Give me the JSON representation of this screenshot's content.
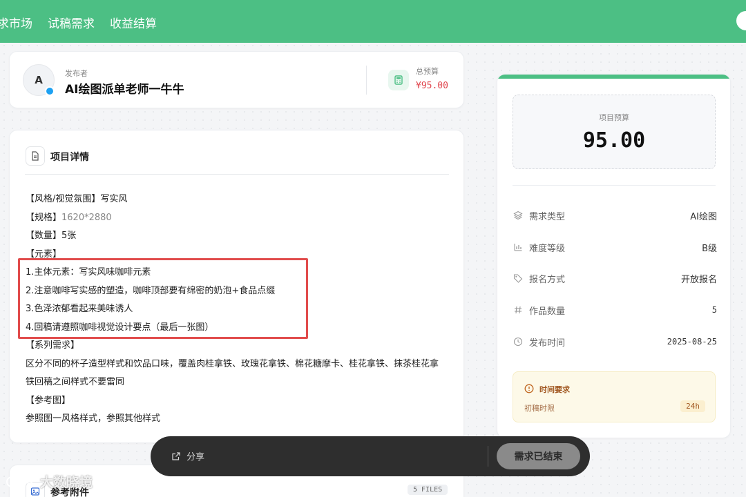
{
  "topnav": {
    "items": [
      "求市场",
      "试稿需求",
      "收益结算"
    ]
  },
  "publisher": {
    "avatar_letter": "A",
    "label": "发布者",
    "name": "AI绘图派单老师一牛牛",
    "budget_label": "总预算",
    "budget_value": "¥95.00"
  },
  "detail": {
    "title": "项目详情",
    "lines": [
      "【风格/视觉氛围】写实风",
      "【规格】1620*2880",
      "【数量】5张",
      "【元素】",
      "1.主体元素：写实风味咖啡元素",
      "2.注意咖啡写实感的塑造，咖啡顶部要有绵密的奶泡+食品点缀",
      "3.色泽浓郁看起来美味诱人",
      "4.回稿请遵照咖啡视觉设计要点（最后一张图）",
      "【系列需求】",
      "区分不同的杯子造型样式和饮品口味，覆盖肉桂拿铁、玫瑰花拿铁、棉花糖摩卡、桂花拿铁、抹茶桂花拿",
      "铁回稿之间样式不要雷同",
      "【参考图】",
      "参照图一风格样式，参照其他样式"
    ],
    "spec_prefix": "【规格】",
    "spec_value": "1620*2880"
  },
  "attachments": {
    "title": "参考附件",
    "badge": "5 FILES"
  },
  "side": {
    "budget_label": "项目预算",
    "budget_value": "95.00",
    "rows": [
      {
        "label": "需求类型",
        "value": "AI绘图",
        "icon": "layers-icon"
      },
      {
        "label": "难度等级",
        "value": "B级",
        "icon": "bar-chart-icon"
      },
      {
        "label": "报名方式",
        "value": "开放报名",
        "icon": "tag-icon"
      },
      {
        "label": "作品数量",
        "value": "5",
        "icon": "hash-icon"
      },
      {
        "label": "发布时间",
        "value": "2025-08-25",
        "icon": "clock-icon"
      }
    ],
    "time": {
      "title": "时间要求",
      "sub_label": "初稿时限",
      "value": "24h"
    }
  },
  "bottom_bar": {
    "share_label": "分享",
    "ended_label": "需求已结束"
  },
  "watermark": {
    "text": "大数晓境"
  },
  "colors": {
    "brand_green": "#4cbf84",
    "price_red": "#e0454d",
    "highlight_red": "#e14c4c",
    "warning_bg": "#fdf9e8"
  }
}
